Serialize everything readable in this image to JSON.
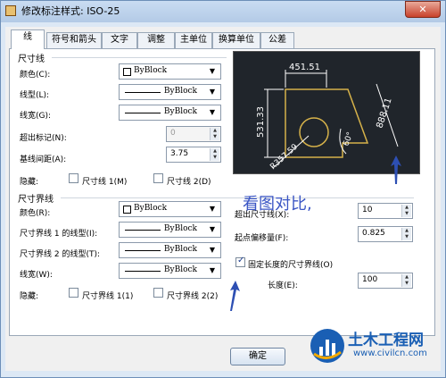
{
  "window": {
    "title": "修改标注样式: ISO-25",
    "close_label": "✕"
  },
  "tabs": [
    {
      "label": "线",
      "active": true
    },
    {
      "label": "符号和箭头",
      "active": false
    },
    {
      "label": "文字",
      "active": false
    },
    {
      "label": "调整",
      "active": false
    },
    {
      "label": "主单位",
      "active": false
    },
    {
      "label": "换算单位",
      "active": false
    },
    {
      "label": "公差",
      "active": false
    }
  ],
  "dim_lines": {
    "group_label": "尺寸线",
    "color": {
      "label": "颜色(C):",
      "value": "ByBlock"
    },
    "linetype": {
      "label": "线型(L):",
      "value": "ByBlock"
    },
    "lineweight": {
      "label": "线宽(G):",
      "value": "ByBlock"
    },
    "extend_beyond_ticks": {
      "label": "超出标记(N):",
      "value": "0"
    },
    "baseline_spacing": {
      "label": "基线间距(A):",
      "value": "3.75"
    },
    "suppress": {
      "label": "隐藏:",
      "line1": "尺寸线 1(M)",
      "line2": "尺寸线 2(D)"
    }
  },
  "ext_lines": {
    "group_label": "尺寸界线",
    "color": {
      "label": "颜色(R):",
      "value": "ByBlock"
    },
    "linetype1": {
      "label": "尺寸界线 1 的线型(I):",
      "value": "ByBlock"
    },
    "linetype2": {
      "label": "尺寸界线 2 的线型(T):",
      "value": "ByBlock"
    },
    "lineweight": {
      "label": "线宽(W):",
      "value": "ByBlock"
    },
    "suppress": {
      "label": "隐藏:",
      "line1": "尺寸界线 1(1)",
      "line2": "尺寸界线 2(2)"
    },
    "extend_beyond": {
      "label": "超出尺寸线(X):",
      "value": "10"
    },
    "offset_from_origin": {
      "label": "起点偏移量(F):",
      "value": "0.825"
    },
    "fixed_length": {
      "label": "固定长度的尺寸界线(O)",
      "checked": true
    },
    "length": {
      "label": "长度(E):",
      "value": "100"
    }
  },
  "preview": {
    "dim_top": "451.51",
    "dim_left": "531.33",
    "dim_right": "888.11",
    "angle": "60°",
    "radius": "R357.59"
  },
  "annotation": {
    "text": "看图对比,"
  },
  "buttons": {
    "ok": "确定"
  },
  "watermark": {
    "title": "土木工程网",
    "url": "www.civilcn.com"
  },
  "colors": {
    "accent": "#3a55c4",
    "preview_bg": "#20252b",
    "preview_line": "#d6b24a",
    "preview_text": "#ffffff"
  }
}
